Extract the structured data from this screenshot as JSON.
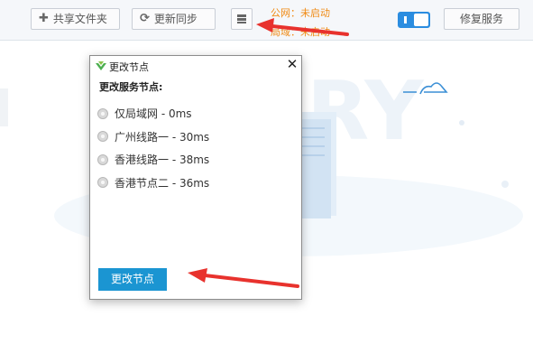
{
  "toolbar": {
    "share_folder_label": "共享文件夹",
    "update_sync_label": "更新同步",
    "repair_service_label": "修复服务"
  },
  "status": {
    "public_net": "公网：未启动",
    "lan_net": "局域：未启动"
  },
  "dialog": {
    "title": "更改节点",
    "heading": "更改服务节点:",
    "options": [
      "仅局域网 - 0ms",
      "广州线路一 - 30ms",
      "香港线路一 - 38ms",
      "香港节点二 - 36ms"
    ],
    "confirm_label": "更改节点",
    "close_glyph": "✕"
  },
  "colors": {
    "accent": "#1b95d2",
    "annotation_arrow": "#e8322d",
    "status_text": "#f08a13",
    "toggle": "#2b8de0"
  }
}
